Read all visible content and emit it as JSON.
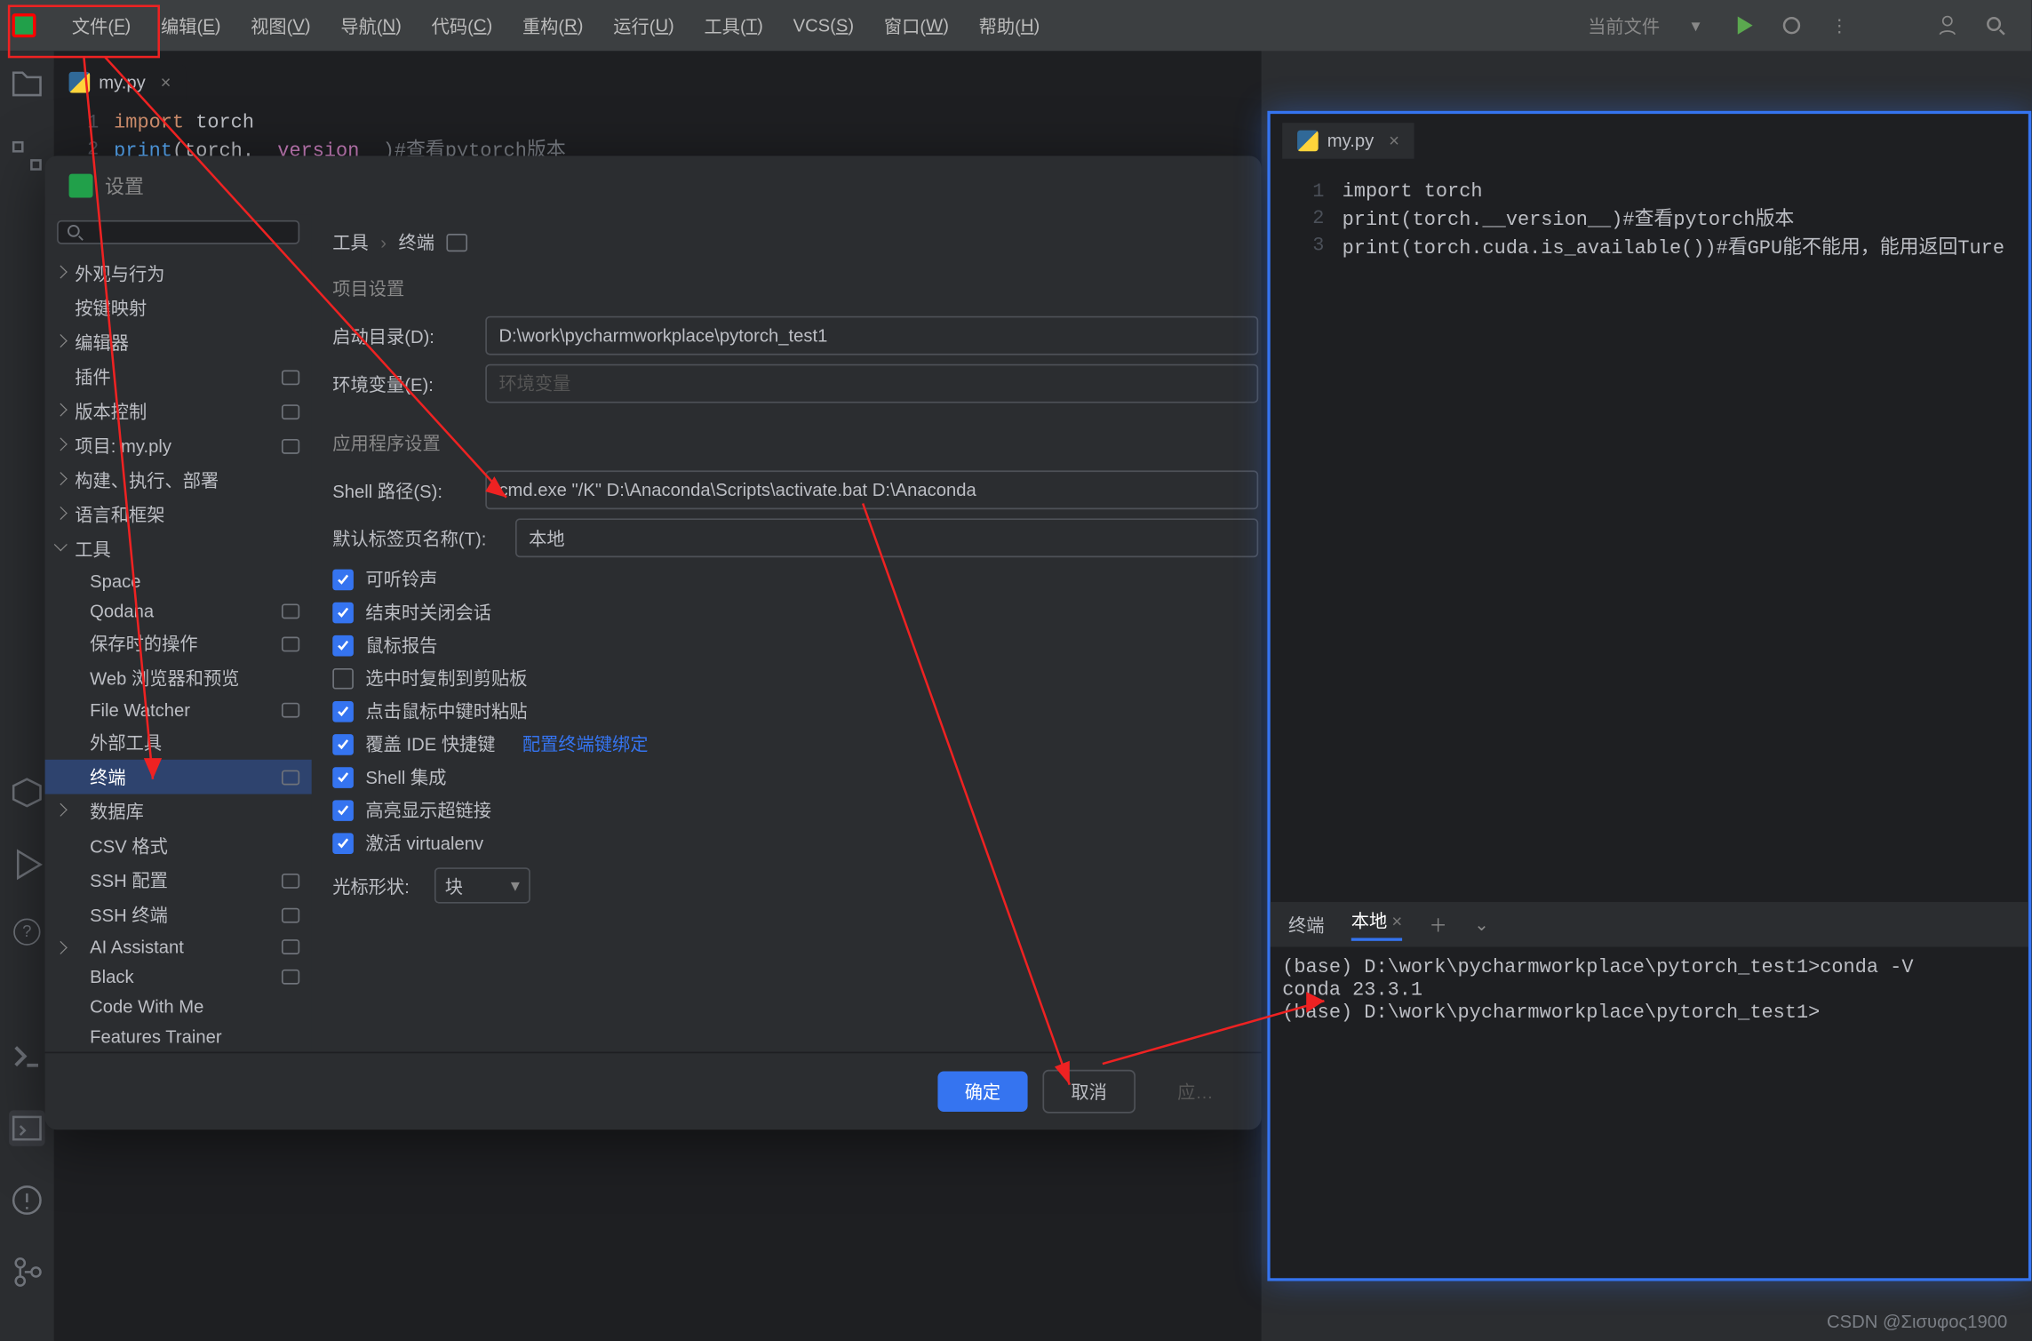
{
  "menu": {
    "items": [
      "文件(F)",
      "编辑(E)",
      "视图(V)",
      "导航(N)",
      "代码(C)",
      "重构(R)",
      "运行(U)",
      "工具(T)",
      "VCS(S)",
      "窗口(W)",
      "帮助(H)"
    ],
    "right_label": "当前文件"
  },
  "left_editor": {
    "tab": "my.py",
    "gutter": [
      "1",
      "2"
    ],
    "code_lines": [
      [
        {
          "t": "import",
          "c": "kw"
        },
        {
          "t": " torch",
          "c": ""
        }
      ],
      [
        {
          "t": "print",
          "c": "fn"
        },
        {
          "t": "(torch.",
          "c": ""
        },
        {
          "t": "__version__",
          "c": "v"
        },
        {
          "t": ")#查看pytorch版本",
          "c": "cm"
        }
      ]
    ]
  },
  "right_editor": {
    "tab": "my.py",
    "gutter": [
      "1",
      "2",
      "3"
    ],
    "code_lines": [
      [
        {
          "t": "import",
          "c": "kw"
        },
        {
          "t": " torch",
          "c": ""
        }
      ],
      [
        {
          "t": "print",
          "c": "fn"
        },
        {
          "t": "(torch.",
          "c": ""
        },
        {
          "t": "__version__",
          "c": "v"
        },
        {
          "t": ")",
          "c": ""
        },
        {
          "t": "#查看pytorch版本",
          "c": "cm"
        }
      ],
      [
        {
          "t": "print",
          "c": "fn"
        },
        {
          "t": "(torch.cuda.is_available())",
          "c": ""
        },
        {
          "t": "#看GPU能不能用，能用返回Ture",
          "c": "cm"
        }
      ]
    ]
  },
  "settings": {
    "title": "设置",
    "breadcrumb": [
      "工具",
      "终端"
    ],
    "tree": [
      {
        "label": "外观与行为",
        "lvl": 1,
        "arrow": true
      },
      {
        "label": "按键映射",
        "lvl": 1
      },
      {
        "label": "编辑器",
        "lvl": 1,
        "arrow": true
      },
      {
        "label": "插件",
        "lvl": 1,
        "has": true
      },
      {
        "label": "版本控制",
        "lvl": 1,
        "arrow": true,
        "has": true
      },
      {
        "label": "项目: my.ply",
        "lvl": 1,
        "arrow": true,
        "has": true
      },
      {
        "label": "构建、执行、部署",
        "lvl": 1,
        "arrow": true
      },
      {
        "label": "语言和框架",
        "lvl": 1,
        "arrow": true
      },
      {
        "label": "工具",
        "lvl": 1,
        "arrow": true,
        "open": true
      },
      {
        "label": "Space",
        "lvl": 2
      },
      {
        "label": "Qodana",
        "lvl": 2,
        "has": true
      },
      {
        "label": "保存时的操作",
        "lvl": 2,
        "has": true
      },
      {
        "label": "Web 浏览器和预览",
        "lvl": 2
      },
      {
        "label": "File Watcher",
        "lvl": 2,
        "has": true
      },
      {
        "label": "外部工具",
        "lvl": 2
      },
      {
        "label": "终端",
        "lvl": 2,
        "has": true,
        "selected": true
      },
      {
        "label": "数据库",
        "lvl": 2,
        "arrow": true
      },
      {
        "label": "CSV 格式",
        "lvl": 2
      },
      {
        "label": "SSH 配置",
        "lvl": 2,
        "has": true
      },
      {
        "label": "SSH 终端",
        "lvl": 2,
        "has": true
      },
      {
        "label": "AI Assistant",
        "lvl": 2,
        "arrow": true,
        "has": true
      },
      {
        "label": "Black",
        "lvl": 2,
        "has": true
      },
      {
        "label": "Code With Me",
        "lvl": 2
      },
      {
        "label": "Features Trainer",
        "lvl": 2
      }
    ],
    "section1": "项目设置",
    "start_dir_label": "启动目录(D):",
    "start_dir": "D:\\work\\pycharmworkplace\\pytorch_test1",
    "env_label": "环境变量(E):",
    "env_placeholder": "环境变量",
    "section2": "应用程序设置",
    "shell_label": "Shell 路径(S):",
    "shell_path": "cmd.exe \"/K\" D:\\Anaconda\\Scripts\\activate.bat D:\\Anaconda",
    "tabname_label": "默认标签页名称(T):",
    "tabname": "本地",
    "checks": [
      {
        "label": "可听铃声",
        "on": true
      },
      {
        "label": "结束时关闭会话",
        "on": true
      },
      {
        "label": "鼠标报告",
        "on": true
      },
      {
        "label": "选中时复制到剪贴板",
        "on": false
      },
      {
        "label": "点击鼠标中键时粘贴",
        "on": true
      },
      {
        "label": "覆盖 IDE 快捷键",
        "on": true,
        "link": "配置终端键绑定"
      },
      {
        "label": "Shell 集成",
        "on": true
      },
      {
        "label": "高亮显示超链接",
        "on": true
      },
      {
        "label": "激活 virtualenv",
        "on": true
      }
    ],
    "cursor_label": "光标形状:",
    "cursor_value": "块",
    "btn_ok": "确定",
    "btn_cancel": "取消",
    "btn_apply": "应…"
  },
  "term": {
    "tab_terminal": "终端",
    "tab_local": "本地",
    "lines": [
      "(base) D:\\work\\pycharmworkplace\\pytorch_test1>conda -V",
      "conda 23.3.1",
      "",
      "(base) D:\\work\\pycharmworkplace\\pytorch_test1>"
    ]
  },
  "watermark": "CSDN @Σισυφος1900"
}
